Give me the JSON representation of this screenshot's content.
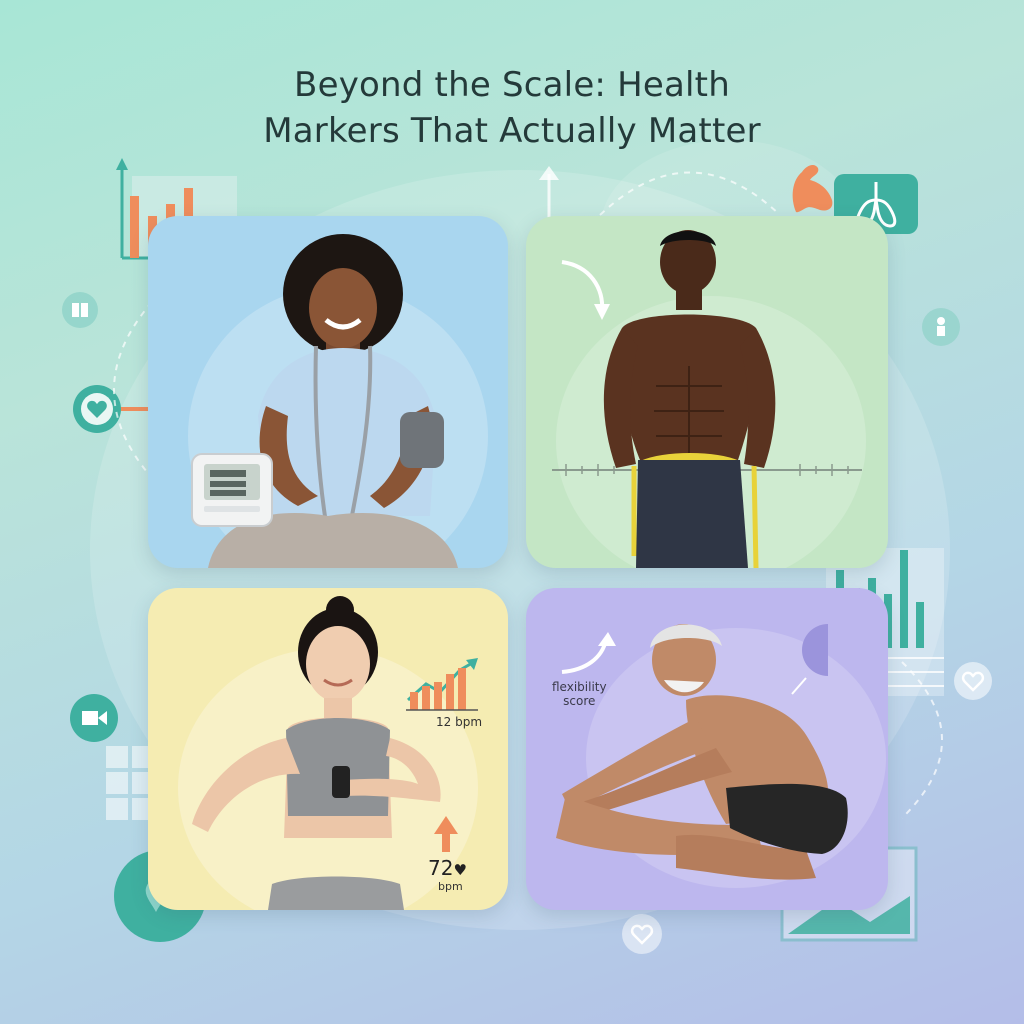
{
  "title": {
    "line1": "Beyond the Scale: Health",
    "line2": "Markers That Actually Matter"
  },
  "colors": {
    "panel_blood_pressure": "#a9d6ef",
    "panel_waist": "#c4e6c5",
    "panel_heart_rate": "#f5ecb2",
    "panel_flexibility": "#bdb7ee",
    "accent_orange": "#ef8d5c",
    "accent_teal": "#3fb0a0"
  },
  "panels": [
    {
      "name": "blood-pressure-panel",
      "icon": "blood-pressure-monitor-icon"
    },
    {
      "name": "waist-measurement-panel",
      "icon": "measuring-tape-icon"
    },
    {
      "name": "resting-heart-rate-panel",
      "icon": "smartwatch-icon",
      "trend_label": "12 bpm",
      "heart_rate_value": "72",
      "heart_rate_unit": "bpm"
    },
    {
      "name": "flexibility-panel",
      "icon": "stretch-icon",
      "score_label_line1": "flexibility",
      "score_label_line2": "score"
    }
  ],
  "decorations": [
    "bar-chart-icon",
    "arrow-up-icon",
    "flexed-arm-icon",
    "lungs-icon",
    "heart-icon",
    "book-icon",
    "figure-icon",
    "video-icon",
    "calendar-grid-icon",
    "location-pin-icon",
    "trend-bars-icon",
    "image-icon"
  ]
}
